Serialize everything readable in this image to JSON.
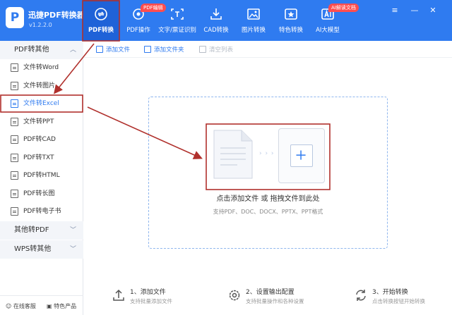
{
  "app": {
    "name": "迅捷PDF转换器",
    "version": "v1.2.2.0"
  },
  "nav": [
    {
      "label": "PDF转换",
      "icon": "convert-icon"
    },
    {
      "label": "PDF操作",
      "icon": "pdf-operate-icon",
      "badge": "PDF编辑"
    },
    {
      "label": "文字/票证识别",
      "icon": "ocr-icon"
    },
    {
      "label": "CAD转换",
      "icon": "cad-icon"
    },
    {
      "label": "图片转换",
      "icon": "image-icon"
    },
    {
      "label": "特色转换",
      "icon": "special-icon"
    },
    {
      "label": "AI大模型",
      "icon": "ai-icon",
      "badge": "AI解读文档"
    }
  ],
  "sidebar": {
    "group1": "PDF转其他",
    "items": [
      "文件转Word",
      "文件转图片",
      "文件转Excel",
      "文件转PPT",
      "PDF转CAD",
      "PDF转TXT",
      "PDF转HTML",
      "PDF转长图",
      "PDF转电子书"
    ],
    "group2": "其他转PDF",
    "group3": "WPS转其他",
    "footer": [
      "在线客服",
      "特色产品"
    ]
  },
  "toolbar": {
    "add_file": "添加文件",
    "add_folder": "添加文件夹",
    "clear": "清空列表"
  },
  "dropzone": {
    "title": "点击添加文件 或 拖拽文件到此处",
    "subtitle": "支持PDF、DOC、DOCX、PPTX、PPT格式",
    "arrows": "› › ›",
    "plus": "+"
  },
  "steps": [
    {
      "title": "1、添加文件",
      "sub": "支持批量添加文件"
    },
    {
      "title": "2、设置输出配置",
      "sub": "支持批量操作和各种设置"
    },
    {
      "title": "3、开始转换",
      "sub": "点击转换按钮开始转换"
    }
  ],
  "colors": {
    "brand": "#2f7bf0",
    "annotation": "#b0302c",
    "badge": "#ff4d4f"
  }
}
